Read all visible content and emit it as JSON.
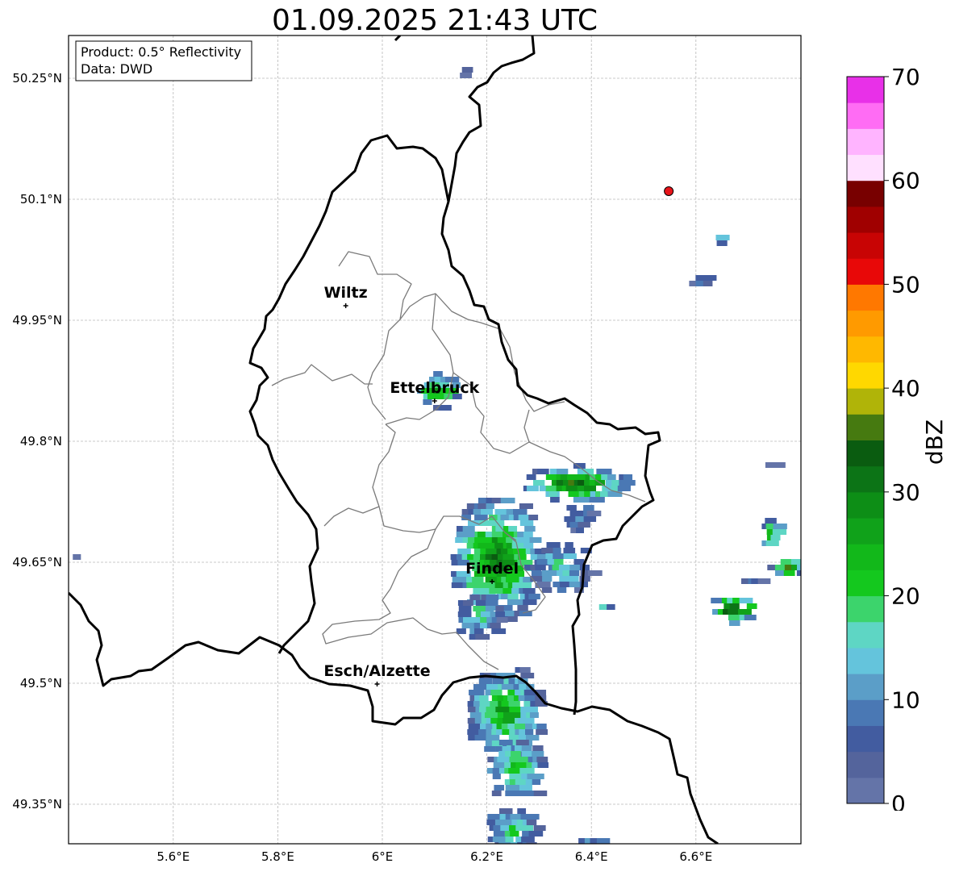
{
  "title": "01.09.2025 21:43 UTC",
  "info_box": {
    "product": "Product: 0.5° Reflectivity",
    "data": "Data: DWD"
  },
  "map_extent": {
    "lon": [
      5.4,
      6.8
    ],
    "lat": [
      49.3,
      50.3
    ]
  },
  "lat_ticks": [
    {
      "value": 50.25,
      "label": "50.25°N"
    },
    {
      "value": 50.1,
      "label": "50.1°N"
    },
    {
      "value": 49.95,
      "label": "49.95°N"
    },
    {
      "value": 49.8,
      "label": "49.8°N"
    },
    {
      "value": 49.65,
      "label": "49.65°N"
    },
    {
      "value": 49.5,
      "label": "49.5°N"
    },
    {
      "value": 49.35,
      "label": "49.35°N"
    }
  ],
  "lon_ticks": [
    {
      "value": 5.6,
      "label": "5.6°E"
    },
    {
      "value": 5.8,
      "label": "5.8°E"
    },
    {
      "value": 6.0,
      "label": "6°E"
    },
    {
      "value": 6.2,
      "label": "6.2°E"
    },
    {
      "value": 6.4,
      "label": "6.4°E"
    },
    {
      "value": 6.6,
      "label": "6.6°E"
    }
  ],
  "cities": [
    {
      "name": "Wiltz",
      "lon": 5.93,
      "lat": 49.968
    },
    {
      "name": "Ettelbruck",
      "lon": 6.1,
      "lat": 49.85
    },
    {
      "name": "Findel",
      "lon": 6.21,
      "lat": 49.626
    },
    {
      "name": "Esch/Alzette",
      "lon": 5.99,
      "lat": 49.499
    }
  ],
  "radar_marker": {
    "lon": 6.548,
    "lat": 50.11,
    "color": "#e8141a"
  },
  "colorbar": {
    "label": "dBZ",
    "min": 0,
    "max": 70,
    "step": 2.5,
    "ticks": [
      {
        "value": 0,
        "label": "0"
      },
      {
        "value": 10,
        "label": "10"
      },
      {
        "value": 20,
        "label": "20"
      },
      {
        "value": 30,
        "label": "30"
      },
      {
        "value": 40,
        "label": "40"
      },
      {
        "value": 50,
        "label": "50"
      },
      {
        "value": 60,
        "label": "60"
      },
      {
        "value": 70,
        "label": "70"
      }
    ],
    "colors": [
      "#6474a8",
      "#54649c",
      "#425ca0",
      "#4a78b4",
      "#5b9ec8",
      "#64c4dc",
      "#5ed6c4",
      "#3cd46c",
      "#14c81e",
      "#12b81a",
      "#10a21a",
      "#0d8e16",
      "#0c7416",
      "#0a5c10",
      "#467a10",
      "#b0b408",
      "#ffd800",
      "#ffb800",
      "#ff9a00",
      "#ff7800",
      "#e80808",
      "#c80404",
      "#a00000",
      "#780000",
      "#ffe0ff",
      "#ffb4ff",
      "#ff6cf4",
      "#e830e8"
    ]
  },
  "colors": {
    "border": "#000000",
    "canton_lines": "#7a7a7a",
    "grid": "#b8b8b8"
  }
}
